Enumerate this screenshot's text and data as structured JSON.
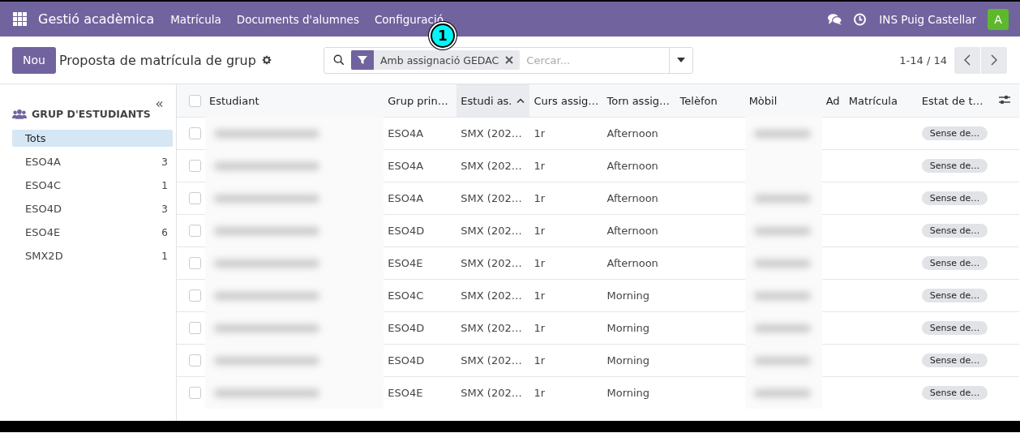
{
  "navbar": {
    "app_title": "Gestió acadèmica",
    "menu": [
      "Matrícula",
      "Documents d'alumnes",
      "Configuració"
    ],
    "company": "INS Puig Castellar",
    "avatar": "A"
  },
  "control_panel": {
    "new_button": "Nou",
    "title": "Proposta de matrícula de grup",
    "facet": "Amb assignació GEDAC",
    "search_placeholder": "Cercar...",
    "pager": "1-14 / 14"
  },
  "marker": "1",
  "sidebar": {
    "title": "GRUP D'ESTUDIANTS",
    "items": [
      {
        "label": "Tots",
        "selected": true
      },
      {
        "label": "ESO4A",
        "count": "3",
        "selected": false
      },
      {
        "label": "ESO4C",
        "count": "1",
        "selected": false
      },
      {
        "label": "ESO4D",
        "count": "3",
        "selected": false
      },
      {
        "label": "ESO4E",
        "count": "6",
        "selected": false
      },
      {
        "label": "SMX2D",
        "count": "1",
        "selected": false
      }
    ]
  },
  "table": {
    "all_checked": false,
    "columns": [
      {
        "label": "Estudiant",
        "sorted": false
      },
      {
        "label": "Grup prin…",
        "sorted": false
      },
      {
        "label": "Estudi as.",
        "sorted": true
      },
      {
        "label": "Curs assig…",
        "sorted": false
      },
      {
        "label": "Torn assig…",
        "sorted": false
      },
      {
        "label": "Telèfon",
        "sorted": false
      },
      {
        "label": "Mòbil",
        "sorted": false
      },
      {
        "label": "Ad",
        "sorted": false
      },
      {
        "label": "Matrícula",
        "sorted": false
      },
      {
        "label": "Estat de t…",
        "sorted": false
      }
    ],
    "rows": [
      {
        "checked": false,
        "blurred_name": true,
        "group": "ESO4A",
        "study": "SMX (202…",
        "course": "1r",
        "shift": "Afternoon",
        "blurred_mobile": true,
        "status": "Sense de…"
      },
      {
        "checked": false,
        "blurred_name": true,
        "group": "ESO4A",
        "study": "SMX (202…",
        "course": "1r",
        "shift": "Afternoon",
        "blurred_mobile": false,
        "status": "Sense de…"
      },
      {
        "checked": false,
        "blurred_name": true,
        "group": "ESO4A",
        "study": "SMX (202…",
        "course": "1r",
        "shift": "Afternoon",
        "blurred_mobile": true,
        "status": "Sense de…"
      },
      {
        "checked": false,
        "blurred_name": true,
        "group": "ESO4D",
        "study": "SMX (202…",
        "course": "1r",
        "shift": "Afternoon",
        "blurred_mobile": true,
        "status": "Sense de…"
      },
      {
        "checked": false,
        "blurred_name": true,
        "group": "ESO4E",
        "study": "SMX (202…",
        "course": "1r",
        "shift": "Afternoon",
        "blurred_mobile": true,
        "status": "Sense de…"
      },
      {
        "checked": false,
        "blurred_name": true,
        "group": "ESO4C",
        "study": "SMX (202…",
        "course": "1r",
        "shift": "Morning",
        "blurred_mobile": true,
        "status": "Sense de…"
      },
      {
        "checked": false,
        "blurred_name": true,
        "group": "ESO4D",
        "study": "SMX (202…",
        "course": "1r",
        "shift": "Morning",
        "blurred_mobile": true,
        "status": "Sense de…"
      },
      {
        "checked": false,
        "blurred_name": true,
        "group": "ESO4D",
        "study": "SMX (202…",
        "course": "1r",
        "shift": "Morning",
        "blurred_mobile": true,
        "status": "Sense de…"
      },
      {
        "checked": false,
        "blurred_name": true,
        "group": "ESO4E",
        "study": "SMX (202…",
        "course": "1r",
        "shift": "Morning",
        "blurred_mobile": true,
        "status": "Sense de…"
      }
    ]
  }
}
